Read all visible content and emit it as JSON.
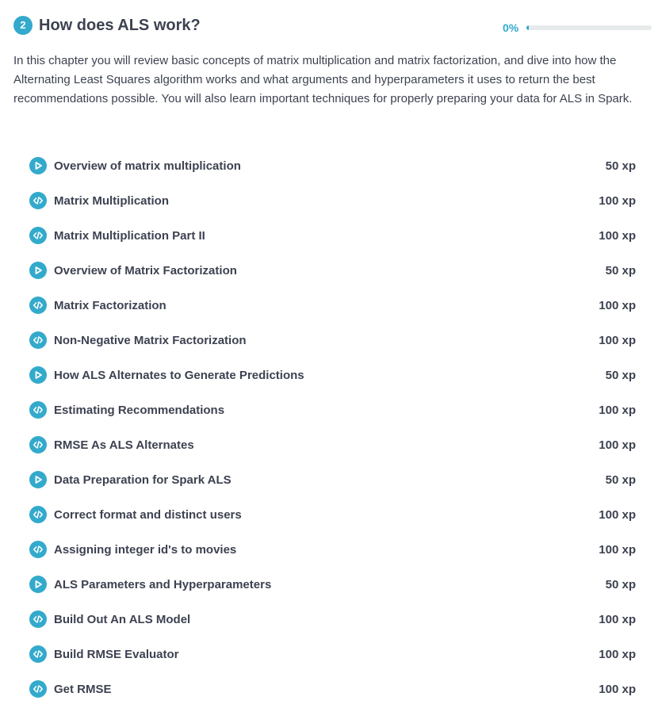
{
  "chapter": {
    "number": "2",
    "title": "How does ALS work?",
    "progress_label": "0%",
    "progress_fraction": 0,
    "description": "In this chapter you will review basic concepts of matrix multiplication and matrix factorization, and dive into how the Alternating Least Squares algorithm works and what arguments and hyperparameters it uses to return the best recommendations possible. You will also learn important techniques for properly preparing your data for ALS in Spark."
  },
  "colors": {
    "accent": "#33aacc",
    "text": "#3d4251",
    "track": "#e6eaeb"
  },
  "exercises": [
    {
      "icon": "play-video-icon",
      "title": "Overview of matrix multiplication",
      "xp": "50 xp"
    },
    {
      "icon": "code-icon",
      "title": "Matrix Multiplication",
      "xp": "100 xp"
    },
    {
      "icon": "code-icon",
      "title": "Matrix Multiplication Part II",
      "xp": "100 xp"
    },
    {
      "icon": "play-video-icon",
      "title": "Overview of Matrix Factorization",
      "xp": "50 xp"
    },
    {
      "icon": "code-icon",
      "title": "Matrix Factorization",
      "xp": "100 xp"
    },
    {
      "icon": "code-icon",
      "title": "Non-Negative Matrix Factorization",
      "xp": "100 xp"
    },
    {
      "icon": "play-video-icon",
      "title": "How ALS Alternates to Generate Predictions",
      "xp": "50 xp"
    },
    {
      "icon": "code-icon",
      "title": "Estimating Recommendations",
      "xp": "100 xp"
    },
    {
      "icon": "code-icon",
      "title": "RMSE As ALS Alternates",
      "xp": "100 xp"
    },
    {
      "icon": "play-video-icon",
      "title": "Data Preparation for Spark ALS",
      "xp": "50 xp"
    },
    {
      "icon": "code-icon",
      "title": "Correct format and distinct users",
      "xp": "100 xp"
    },
    {
      "icon": "code-icon",
      "title": "Assigning integer id's to movies",
      "xp": "100 xp"
    },
    {
      "icon": "play-video-icon",
      "title": "ALS Parameters and Hyperparameters",
      "xp": "50 xp"
    },
    {
      "icon": "code-icon",
      "title": "Build Out An ALS Model",
      "xp": "100 xp"
    },
    {
      "icon": "code-icon",
      "title": "Build RMSE Evaluator",
      "xp": "100 xp"
    },
    {
      "icon": "code-icon",
      "title": "Get RMSE",
      "xp": "100 xp"
    }
  ]
}
